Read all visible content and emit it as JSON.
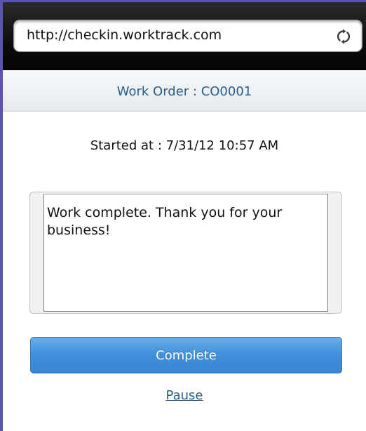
{
  "browser": {
    "url": "http://checkin.worktrack.com",
    "reload_icon": "reload-icon"
  },
  "header": {
    "title": "Work Order : CO0001"
  },
  "started": {
    "text": "Started at : 7/31/12 10:57 AM"
  },
  "notes": {
    "value": "Work complete. Thank you for your business!"
  },
  "actions": {
    "complete_label": "Complete",
    "pause_label": "Pause"
  },
  "colors": {
    "accent": "#3f8fdb",
    "header_text": "#2a5d84",
    "window_border": "#5d53b4"
  }
}
